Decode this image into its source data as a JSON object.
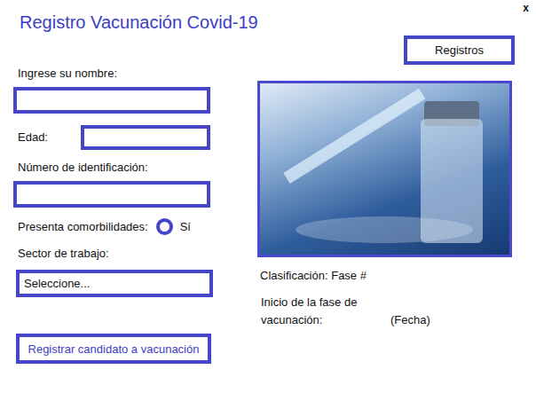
{
  "window": {
    "title": "Registro Vacunación Covid-19",
    "close": "x"
  },
  "records_button": "Registros",
  "form": {
    "name_label": "Ingrese su nombre:",
    "age_label": "Edad:",
    "id_label": "Número de identificación:",
    "comorbidities_label": "Presenta comorbilidades:",
    "comorbidities_options": [
      {
        "label": "Sí",
        "selected": false
      }
    ],
    "sector_label": "Sector de trabajo:",
    "sector_value": "Seleccione...",
    "submit": "Registrar candidato a vacunación"
  },
  "classification": "Clasificación: Fase #",
  "phase_start": {
    "label": "Inicio de la fase de vacunación:",
    "value": "(Fecha)"
  }
}
